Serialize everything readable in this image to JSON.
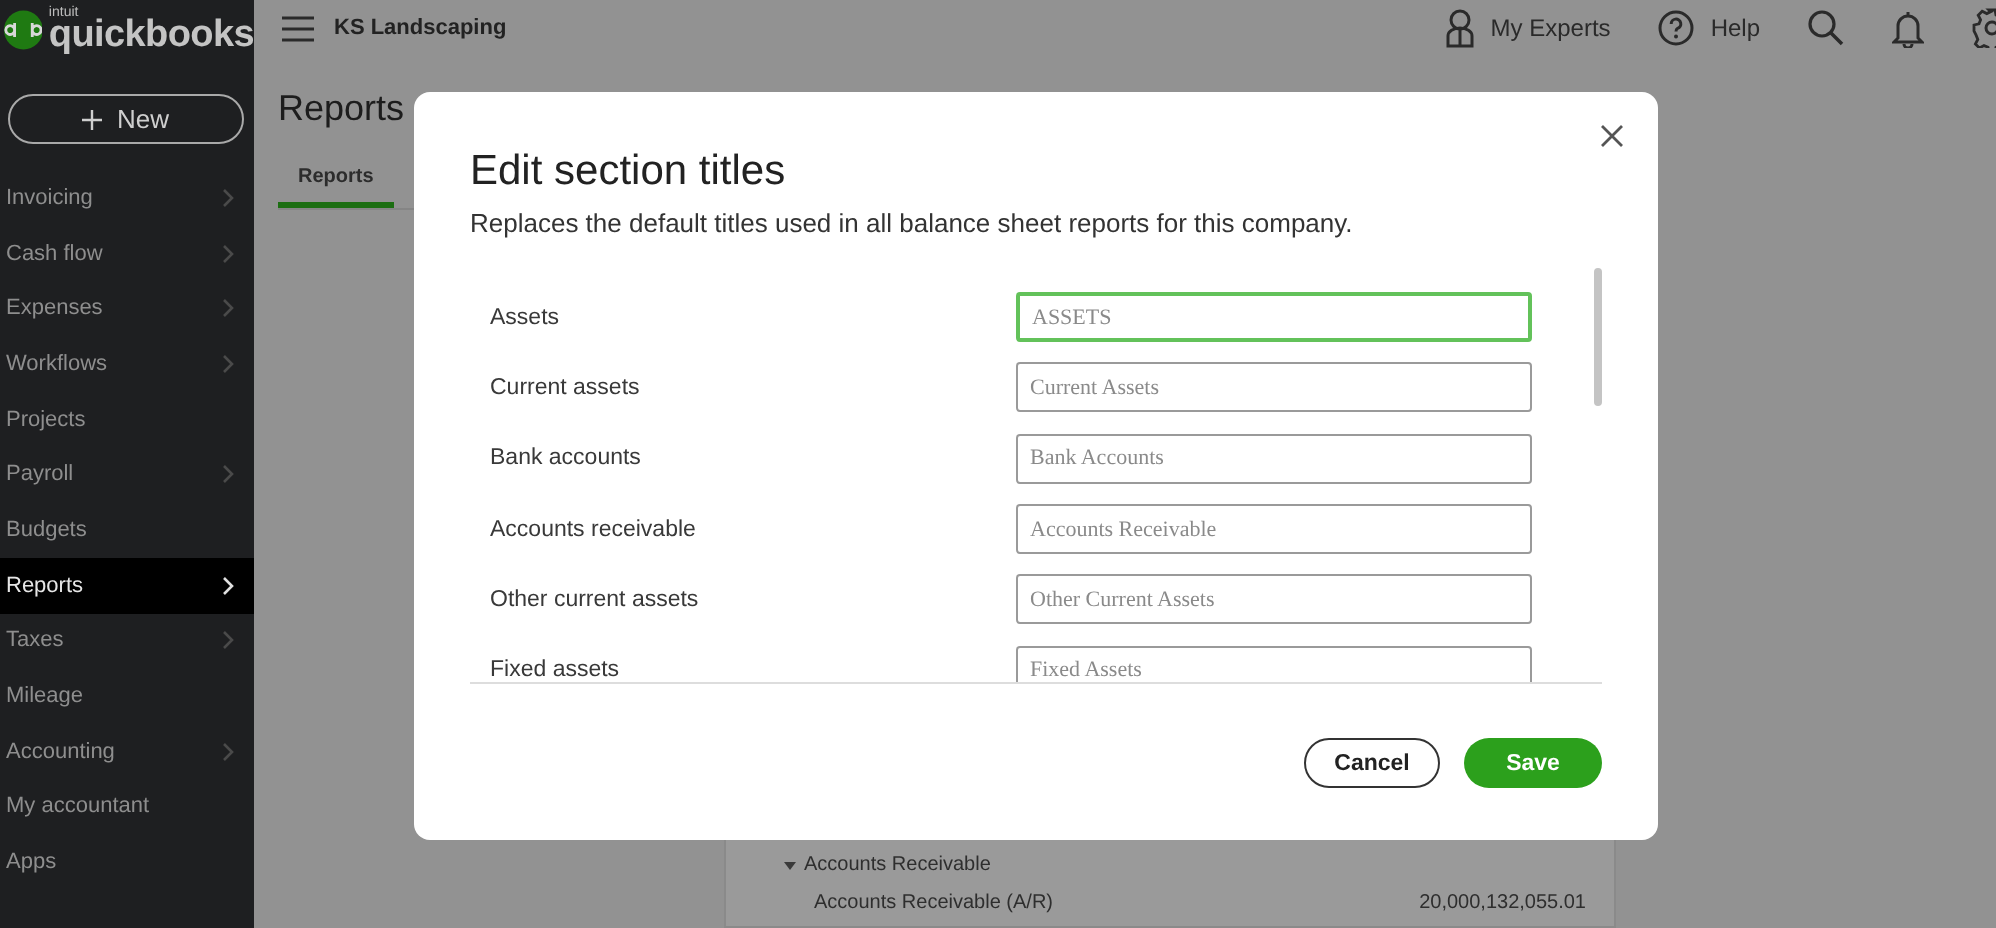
{
  "brand": {
    "small": "intuit",
    "name": "quickbooks"
  },
  "sidebar": {
    "new_button": "New",
    "items": [
      {
        "label": "Invoicing",
        "submenu": true,
        "selected": false
      },
      {
        "label": "Cash flow",
        "submenu": true,
        "selected": false
      },
      {
        "label": "Expenses",
        "submenu": true,
        "selected": false
      },
      {
        "label": "Workflows",
        "submenu": true,
        "selected": false
      },
      {
        "label": "Projects",
        "submenu": false,
        "selected": false
      },
      {
        "label": "Payroll",
        "submenu": true,
        "selected": false
      },
      {
        "label": "Budgets",
        "submenu": false,
        "selected": false
      },
      {
        "label": "Reports",
        "submenu": true,
        "selected": true
      },
      {
        "label": "Taxes",
        "submenu": true,
        "selected": false
      },
      {
        "label": "Mileage",
        "submenu": false,
        "selected": false
      },
      {
        "label": "Accounting",
        "submenu": true,
        "selected": false
      },
      {
        "label": "My accountant",
        "submenu": false,
        "selected": false
      },
      {
        "label": "Apps",
        "submenu": false,
        "selected": false
      }
    ]
  },
  "topbar": {
    "company": "KS Landscaping",
    "my_experts": "My Experts",
    "help": "Help"
  },
  "page": {
    "title": "Reports",
    "tabs": [
      {
        "label": "Reports",
        "selected": true
      }
    ]
  },
  "report": {
    "rows": [
      {
        "label": "Accounts Receivable",
        "expanded": true,
        "amount": ""
      },
      {
        "label": "Accounts Receivable (A/R)",
        "amount": "20,000,132,055.01"
      }
    ]
  },
  "dialog": {
    "title": "Edit section titles",
    "subtitle": "Replaces the default titles used in all balance sheet reports for this company.",
    "fields": [
      {
        "label": "Assets",
        "placeholder": "ASSETS",
        "focused": true
      },
      {
        "label": "Current assets",
        "placeholder": "Current Assets",
        "focused": false
      },
      {
        "label": "Bank accounts",
        "placeholder": "Bank Accounts",
        "focused": false
      },
      {
        "label": "Accounts receivable",
        "placeholder": "Accounts Receivable",
        "focused": false
      },
      {
        "label": "Other current assets",
        "placeholder": "Other Current Assets",
        "focused": false
      },
      {
        "label": "Fixed assets",
        "placeholder": "Fixed Assets",
        "focused": false
      }
    ],
    "cancel": "Cancel",
    "save": "Save"
  }
}
